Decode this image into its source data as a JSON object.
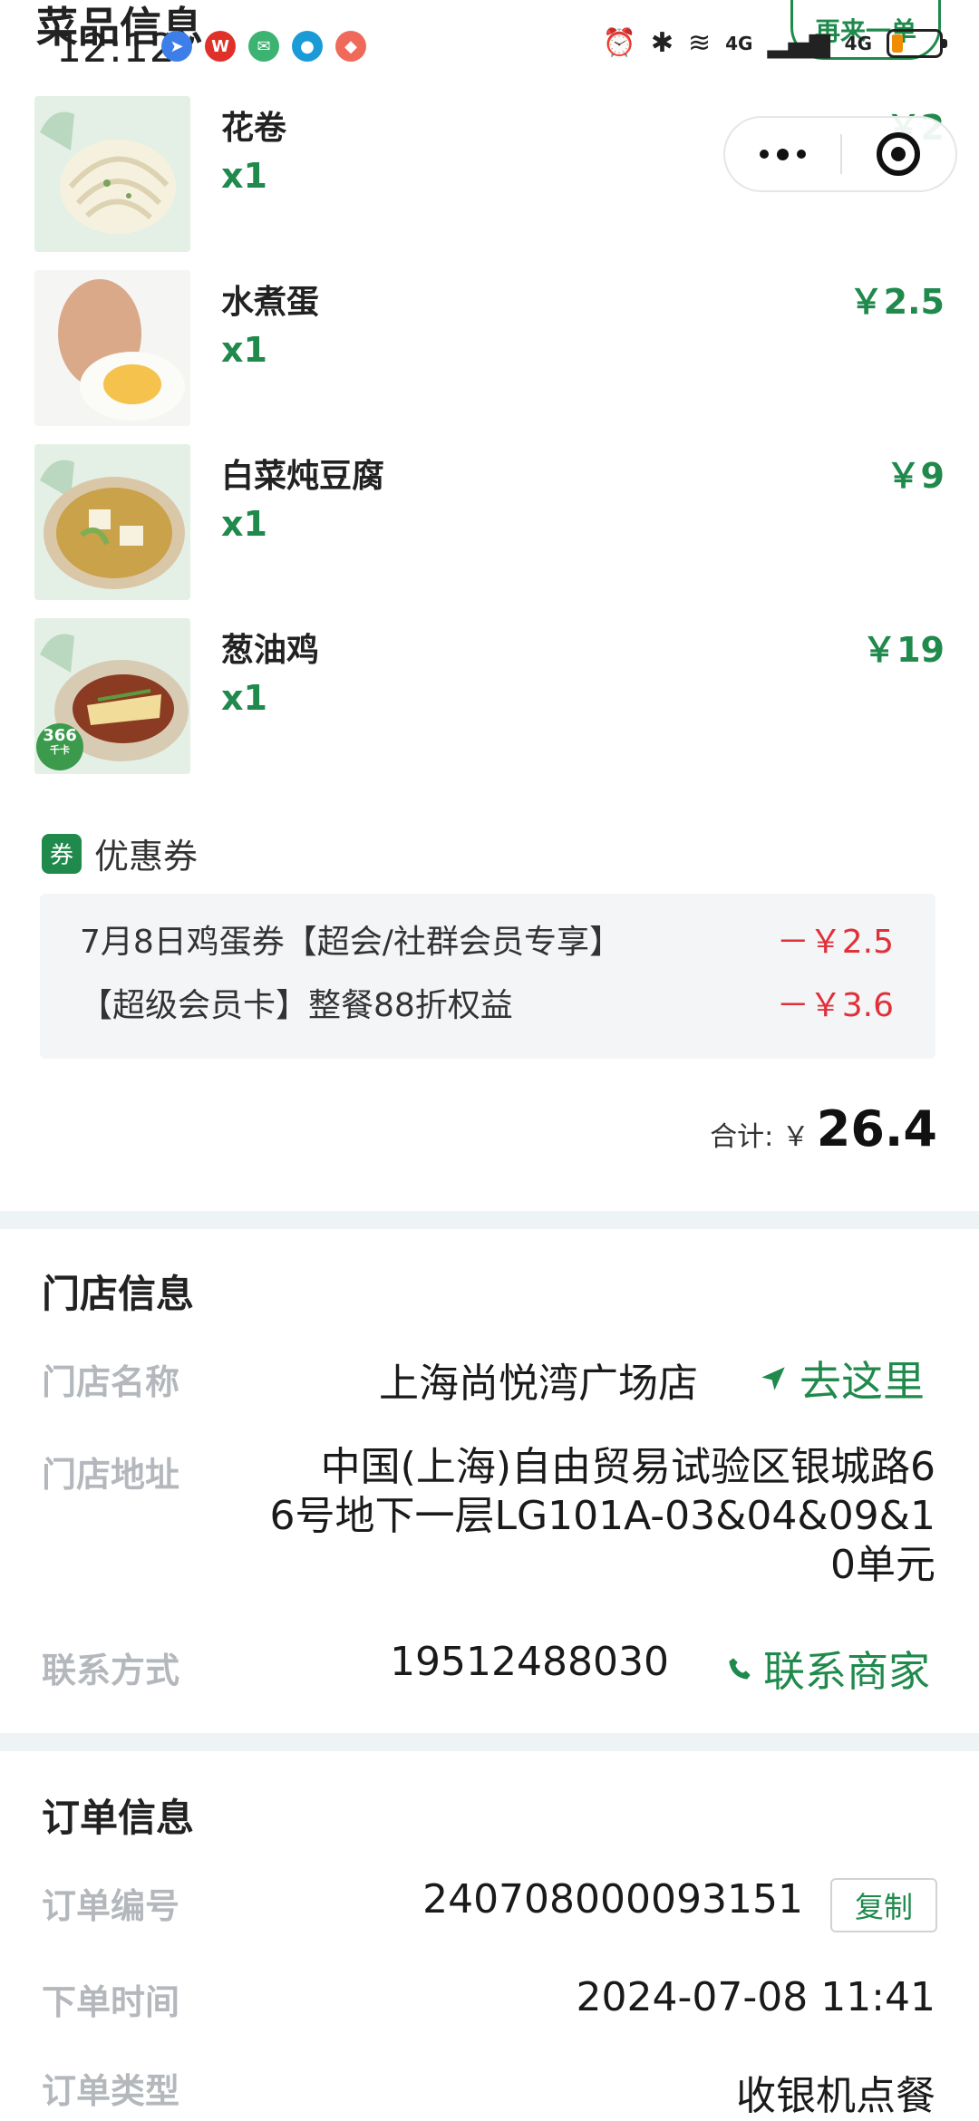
{
  "status_bar": {
    "time": "12:12",
    "network_labels": [
      "4G",
      "4G"
    ],
    "app_icons": [
      "navigation-app-icon",
      "weibo-icon",
      "wechat-icon",
      "map-pin-app-icon",
      "shopping-app-icon"
    ]
  },
  "header": {
    "section_title": "菜品信息",
    "reorder_label": "再来一单"
  },
  "dishes": [
    {
      "name": "花卷",
      "qty": "x1",
      "price": "￥2"
    },
    {
      "name": "水煮蛋",
      "qty": "x1",
      "price": "￥2.5"
    },
    {
      "name": "白菜炖豆腐",
      "qty": "x1",
      "price": "￥9"
    },
    {
      "name": "葱油鸡",
      "qty": "x1",
      "price": "￥19",
      "badge_top": "366",
      "badge_bottom": "千卡"
    }
  ],
  "coupons": {
    "badge": "券",
    "title": "优惠券",
    "items": [
      {
        "name": "7月8日鸡蛋券【超会/社群会员专享】",
        "amount": "－￥2.5"
      },
      {
        "name": "【超级会员卡】整餐88折权益",
        "amount": "－￥3.6"
      }
    ]
  },
  "total": {
    "label": "合计: ￥",
    "value": "26.4"
  },
  "store": {
    "title": "门店信息",
    "name_label": "门店名称",
    "name": "上海尚悦湾广场店",
    "navigate_label": "去这里",
    "address_label": "门店地址",
    "address_lines": [
      "中国(上海)自由贸易试验区银城路6",
      "6号地下一层LG101A-03&04&09&1",
      "0单元"
    ],
    "contact_label": "联系方式",
    "phone": "19512488030",
    "contact_action": "联系商家"
  },
  "order": {
    "title": "订单信息",
    "number_label": "订单编号",
    "number": "240708000093151",
    "copy_label": "复制",
    "time_label": "下单时间",
    "time": "2024-07-08 11:41",
    "type_label": "订单类型",
    "type": "收银机点餐"
  },
  "colors": {
    "brand_green": "#1f8a4c",
    "discount_red": "#e0303a",
    "label_gray": "#b4b8bc",
    "section_band": "#eef3f6"
  }
}
